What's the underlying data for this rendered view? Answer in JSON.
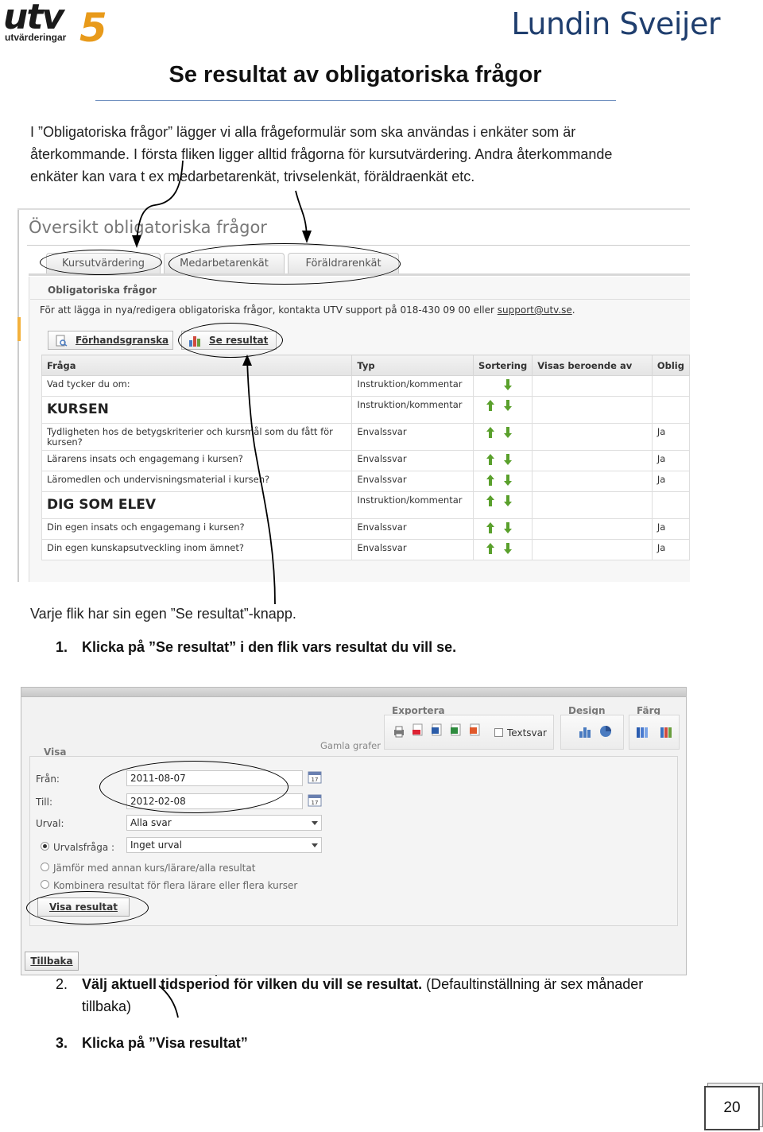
{
  "header": {
    "logo_utv_big": "utv",
    "logo_utv_five": "5",
    "logo_utv_small": "utvärderingar",
    "logo_lundin": "Lundin Sveijer"
  },
  "title": "Se resultat av obligatoriska frågor",
  "intro_lines": [
    "I ”Obligatoriska frågor” lägger vi alla frågeformulär som ska användas i enkäter som är",
    "återkommande. I första fliken ligger alltid frågorna för kursutvärdering.  Andra återkommande",
    "enkäter kan vara t ex medarbetarenkät, trivselenkät, föräldraenkät etc."
  ],
  "overview": {
    "title": "Översikt obligatoriska frågor",
    "tabs": [
      "Kursutvärdering",
      "Medarbetarenkät",
      "Föräldrarenkät"
    ],
    "panel_heading": "Obligatoriska frågor",
    "info_text": "För att lägga in nya/redigera obligatoriska frågor, kontakta UTV support på 018-430 09 00 eller ",
    "info_link": "support@utv.se",
    "info_end": ".",
    "preview_button": "Förhandsgranska",
    "results_button": "Se resultat",
    "columns": [
      "Fråga",
      "Typ",
      "Sortering",
      "Visas beroende av",
      "Oblig"
    ],
    "rows": [
      {
        "q": "Vad tycker du om:",
        "typ": "Instruktion/kommentar",
        "oblig": ""
      },
      {
        "q": "KURSEN",
        "typ": "Instruktion/kommentar",
        "oblig": "",
        "big": true
      },
      {
        "q": "Tydligheten hos de betygskriterier och kursmål som du fått för kursen?",
        "typ": "Envalssvar",
        "oblig": "Ja"
      },
      {
        "q": "Lärarens insats och engagemang i kursen?",
        "typ": "Envalssvar",
        "oblig": "Ja"
      },
      {
        "q": "Läromedlen och undervisningsmaterial i kursen?",
        "typ": "Envalssvar",
        "oblig": "Ja"
      },
      {
        "q": "DIG SOM ELEV",
        "typ": "Instruktion/kommentar",
        "oblig": "",
        "big": true
      },
      {
        "q": "Din egen insats och engagemang i kursen?",
        "typ": "Envalssvar",
        "oblig": "Ja"
      },
      {
        "q": "Din egen kunskapsutveckling inom ämnet?",
        "typ": "Envalssvar",
        "oblig": "Ja"
      }
    ]
  },
  "caption": "Varje flik har sin egen ”Se resultat”-knapp.",
  "step1": {
    "num": "1.",
    "text": "Klicka på ”Se resultat” i den flik vars resultat du vill se."
  },
  "results_ui": {
    "export_label": "Exportera",
    "design_label": "Design",
    "farg_label": "Färg",
    "textsvar": "Textsvar",
    "gamla_grafer": "Gamla grafer",
    "visa_legend": "Visa",
    "fran_label": "Från:",
    "fran_value": "2011-08-07",
    "till_label": "Till:",
    "till_value": "2012-02-08",
    "urval_label": "Urval:",
    "urval_value": "Alla svar",
    "urvalsfraga_label": "Urvalsfråga :",
    "urvalsfraga_value": "Inget urval",
    "option_compare": "Jämför med annan kurs/lärare/alla resultat",
    "option_combine": "Kombinera resultat för flera lärare eller flera kurser",
    "visa_button": "Visa resultat",
    "back_button": "Tillbaka"
  },
  "step2": {
    "num": "2.",
    "bold": "Välj aktuell tidsperiod för vilken du vill se resultat.",
    "normal": " (Defaultinställning är sex månader",
    "line2": "tillbaka)"
  },
  "step3": {
    "num": "3.",
    "text": "Klicka på ”Visa resultat”"
  },
  "page_number": "20"
}
